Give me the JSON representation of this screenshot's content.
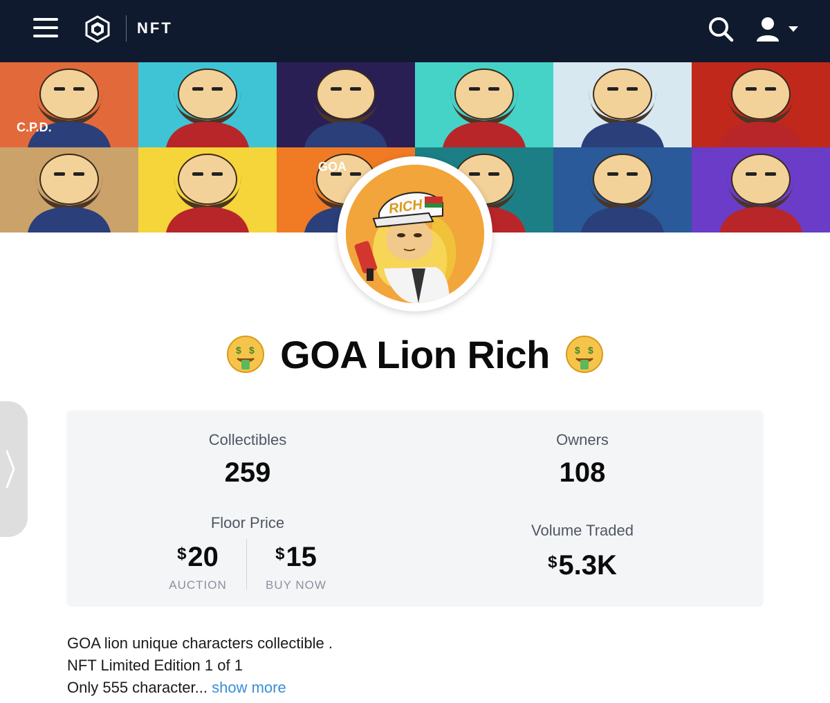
{
  "nav": {
    "brand": "NFT",
    "icons": [
      "menu-icon",
      "crypto-com-logo",
      "search-icon",
      "user-icon",
      "caret-down-icon"
    ]
  },
  "banner": {
    "tile_colors": [
      "#e26a3a",
      "#3fc4d6",
      "#2a1f55",
      "#45d3c8",
      "#d7e8f0",
      "#c0281c",
      "#caa26a",
      "#f5d53a",
      "#f07b24",
      "#1d7f86",
      "#2a5a9a",
      "#6a3cc8"
    ],
    "tile_labels": [
      "C.P.D.",
      "",
      "",
      "",
      "",
      "",
      "",
      "",
      "GOA",
      "",
      "",
      ""
    ]
  },
  "avatar": {
    "cap_text": "RICH",
    "bg": "#f2a53a"
  },
  "collection": {
    "title": "GOA Lion Rich",
    "emoji_icon": "money-mouth-face-icon"
  },
  "stats": {
    "collectibles_label": "Collectibles",
    "collectibles_value": "259",
    "owners_label": "Owners",
    "owners_value": "108",
    "floor_price_label": "Floor Price",
    "currency": "$",
    "auction_value": "20",
    "auction_label": "AUCTION",
    "buy_now_value": "15",
    "buy_now_label": "BUY NOW",
    "volume_label": "Volume Traded",
    "volume_value": "5.3K"
  },
  "description": {
    "line1": "GOA lion unique characters collectible .",
    "line2": "NFT Limited Edition 1 of 1",
    "line3": "Only 555 character...",
    "show_more": "show more"
  },
  "colors": {
    "nav_bg": "#0f1a2e",
    "card_bg": "#f4f5f7",
    "link": "#3a8ed8"
  }
}
